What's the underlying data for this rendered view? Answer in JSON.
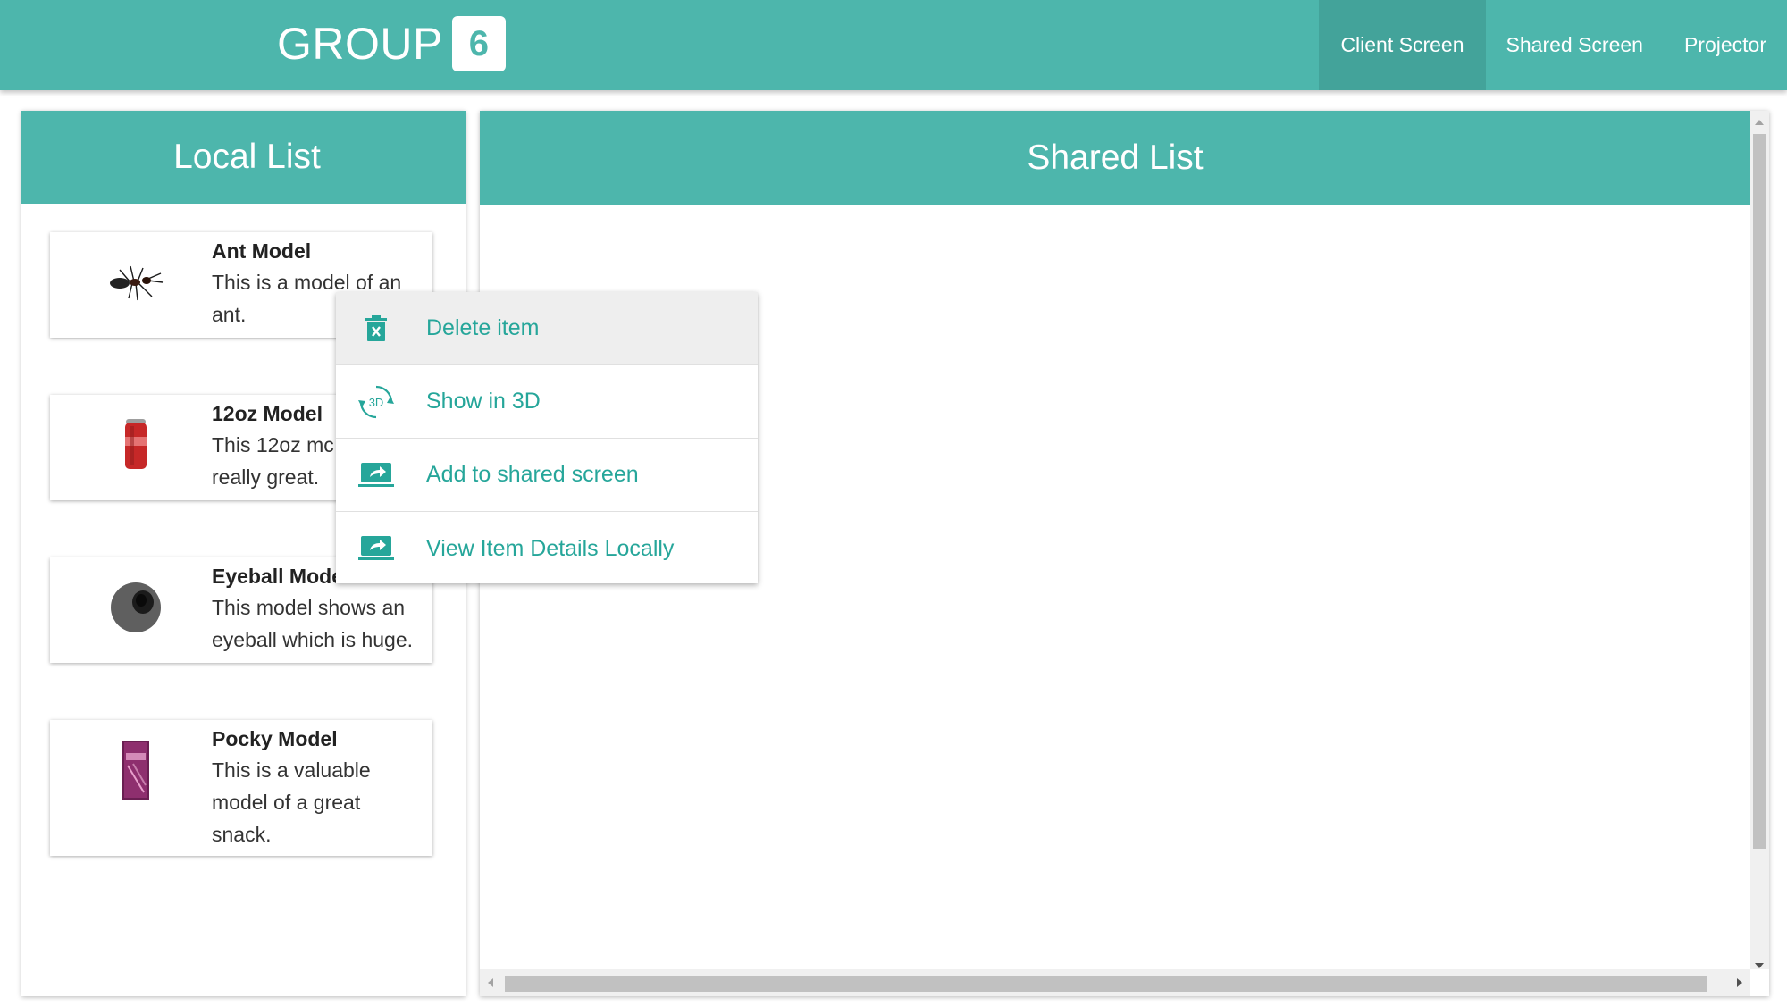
{
  "header": {
    "brand_text": "GROUP",
    "brand_badge": "6",
    "nav": [
      {
        "label": "Client Screen",
        "active": true
      },
      {
        "label": "Shared Screen",
        "active": false
      },
      {
        "label": "Projector",
        "active": false
      }
    ]
  },
  "local_list": {
    "title": "Local List",
    "items": [
      {
        "title": "Ant Model",
        "desc_lines": [
          "This is a model of an",
          "ant."
        ],
        "icon": "ant-icon"
      },
      {
        "title": "12oz Model",
        "desc_lines": [
          "This 12oz mc",
          "really great."
        ],
        "icon": "soda-can-icon"
      },
      {
        "title": "Eyeball Mode",
        "desc_lines": [
          "This model shows an",
          "eyeball which is huge."
        ],
        "icon": "eyeball-icon"
      },
      {
        "title": "Pocky Model",
        "desc_lines": [
          "This is a valuable",
          "model of a great",
          "snack."
        ],
        "icon": "pocky-box-icon"
      }
    ]
  },
  "shared_list": {
    "title": "Shared List"
  },
  "context_menu": {
    "items": [
      {
        "label": "Delete item",
        "icon": "trash-icon",
        "hovered": true
      },
      {
        "label": "Show in 3D",
        "icon": "rotate-3d-icon",
        "hovered": false
      },
      {
        "label": "Add to shared screen",
        "icon": "screen-share-icon",
        "hovered": false
      },
      {
        "label": "View Item Details Locally",
        "icon": "screen-share-icon",
        "hovered": false
      }
    ]
  },
  "colors": {
    "primary": "#4db6ac",
    "primary_dark": "#43a39a",
    "menu_text": "#26a69a",
    "menu_hover": "#eeeeee"
  }
}
